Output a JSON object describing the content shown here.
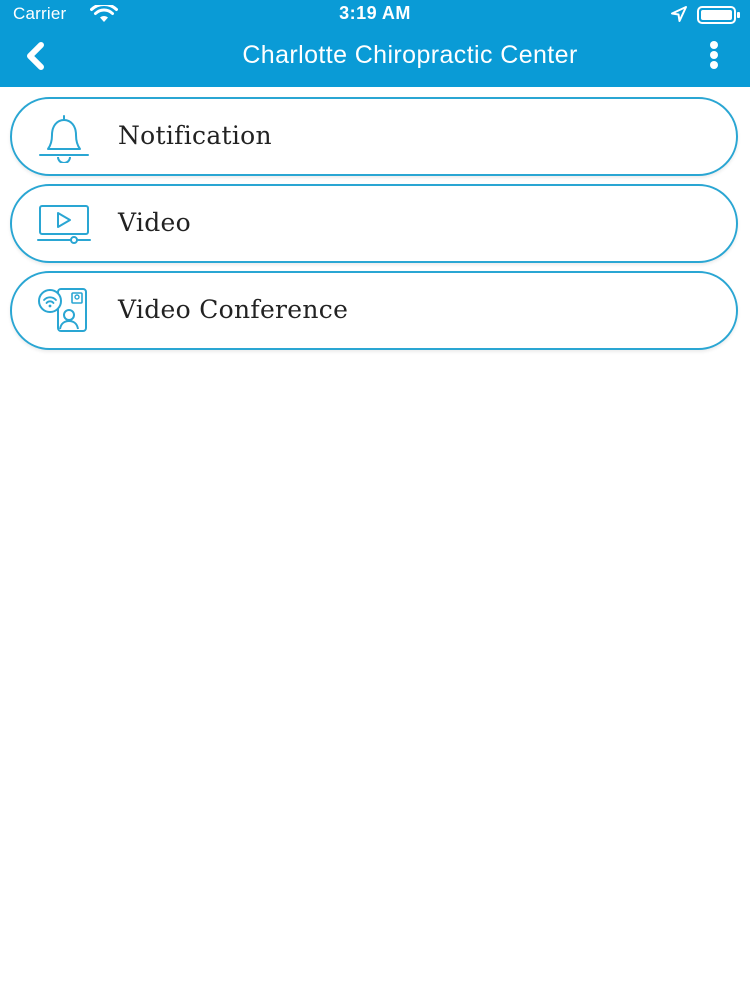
{
  "status_bar": {
    "carrier": "Carrier",
    "time": "3:19 AM",
    "wifi_icon": "wifi-icon",
    "location_icon": "location-arrow-icon",
    "battery_icon": "battery-full-icon"
  },
  "nav": {
    "title": "Charlotte Chiropractic Center",
    "back_icon": "chevron-left-icon",
    "menu_icon": "vertical-ellipsis-icon"
  },
  "menu": {
    "items": [
      {
        "label": "Notification",
        "icon": "bell-icon"
      },
      {
        "label": "Video",
        "icon": "video-play-icon"
      },
      {
        "label": "Video Conference",
        "icon": "video-conference-icon"
      }
    ]
  },
  "colors": {
    "header_bg": "#0a9bd6",
    "item_border": "#2aa6d3",
    "icon_stroke": "#2aa6d3",
    "label_text": "#222222"
  }
}
